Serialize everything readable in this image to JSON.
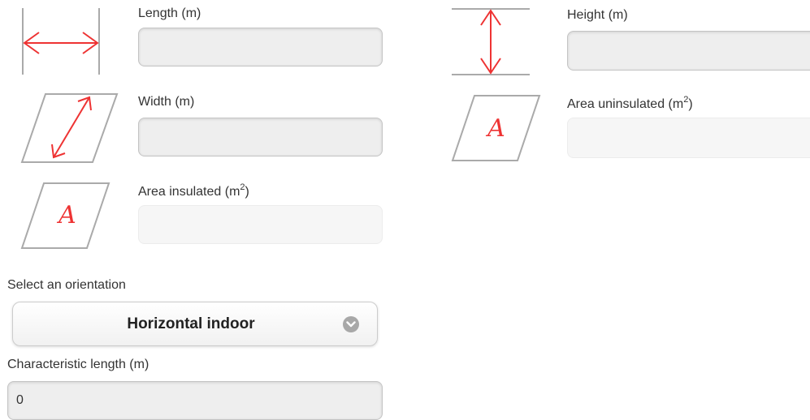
{
  "fields": {
    "length": {
      "label": "Length (m)",
      "value": ""
    },
    "height": {
      "label": "Height (m)",
      "value": ""
    },
    "width": {
      "label": "Width (m)",
      "value": ""
    },
    "area_uninsulated": {
      "label": "Area uninsulated (m",
      "label_sup": "2",
      "label_end": ")",
      "value": ""
    },
    "area_insulated": {
      "label": "Area insulated (m",
      "label_sup": "2",
      "label_end": ")",
      "value": ""
    },
    "characteristic_length": {
      "label": "Characteristic length (m)",
      "value": "0"
    }
  },
  "orientation": {
    "prompt": "Select an orientation",
    "selected": "Horizontal indoor"
  },
  "icons": {
    "area_letter": "A",
    "length": "length-arrow-icon",
    "height": "height-arrow-icon",
    "width": "width-parallelogram-icon",
    "area": "area-parallelogram-icon",
    "dropdown": "chevron-down-icon"
  },
  "colors": {
    "arrow": "#ee3333",
    "icon_stroke": "#aaaaaa",
    "chevron_bg": "#a8a8a8"
  }
}
